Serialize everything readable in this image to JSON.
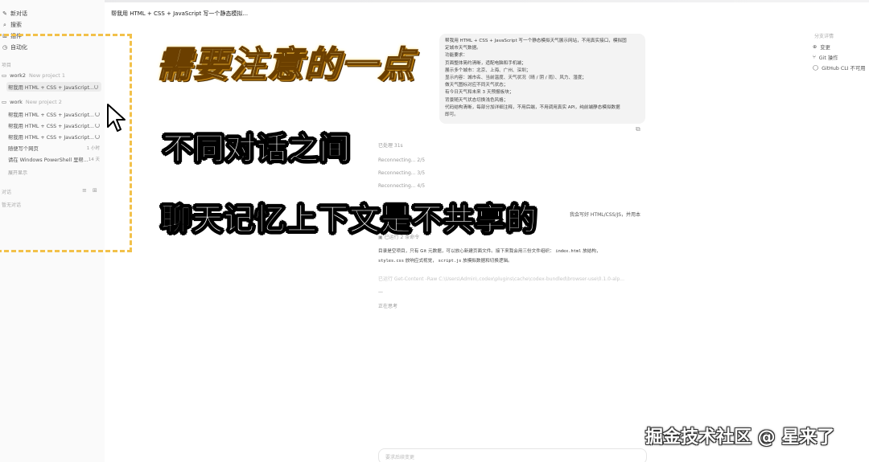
{
  "sidebar": {
    "nav": [
      {
        "icon": "✎",
        "label": "新对话"
      },
      {
        "icon": "⌕",
        "label": "搜索"
      },
      {
        "icon": "⊞",
        "label": "插件"
      },
      {
        "icon": "◷",
        "label": "自动化"
      }
    ],
    "projects_label": "项目",
    "projects": [
      {
        "name": "work2",
        "sub": "New project 1"
      },
      {
        "name": "work",
        "sub": "New project 2"
      }
    ],
    "chats_p1": [
      {
        "title": "帮我用 HTML + CSS + JavaScript...",
        "meta": ""
      }
    ],
    "chats_p2": [
      {
        "title": "帮我用 HTML + CSS + JavaScript...",
        "meta": ""
      },
      {
        "title": "帮我用 HTML + CSS + JavaScript...",
        "meta": ""
      },
      {
        "title": "帮我用 HTML + CSS + JavaScript...",
        "meta": ""
      },
      {
        "title": "随便写个网页",
        "meta": "1 小时"
      },
      {
        "title": "请在 Windows PowerShell 里帮...",
        "meta": "14 天"
      }
    ],
    "expand_label": "展开显示",
    "threads_label": "对话",
    "no_threads": "暂无对话"
  },
  "header": {
    "title": "帮我用 HTML + CSS + JavaScript 写一个静态模拟..."
  },
  "overlays": {
    "yellow": "需要注意的一点",
    "line1": "不同对话之间",
    "line2": "聊天记忆上下文是不共享的"
  },
  "user_message": [
    "帮我用 HTML + CSS + JavaScript 写一个静态模拟天气展示网站，不用真实接口，模拟固",
    "定城市天气数据。",
    "功能要求：",
    "页面整体简约清晰，适配电脑和手机端；",
    "展示多个城市：北京、上海、广州、深圳；",
    "显示内容：城市名、当前温度、天气状况（晴 / 阴 / 雨）、风力、湿度；",
    "做天气图标对应不同天气状态；",
    "有今日天气和未来 3 天预报板块；",
    "背景随天气状态切换浅色风格；",
    "代码结构清晰，每部分加详细注释，不用后端，不用调用真实 API，纯前端静态模拟数据",
    "即可。"
  ],
  "status_lines": [
    "已处理 31s",
    "Reconnecting... 2/5",
    "Reconnecting... 3/5",
    "Reconnecting... 4/5"
  ],
  "partial_reply_right": "我会写好 HTML/CSS/JS，并用本",
  "ran_label": "已运行 2 条命令",
  "reply": {
    "line1_a": "目录是空项目，只有 Git 元数据，可以放心新建页面文件。接下来我会用三份文件组织：",
    "line1_code": "index.html",
    "line1_b": "放结构，",
    "line2_code1": "styles.css",
    "line2_a": "放响应式视觉，",
    "line2_code2": "script.js",
    "line2_b": "放模拟数据和切换逻辑。"
  },
  "ran_cmd": "已运行 Get-Content -Raw C:\\Users\\Admin\\.codex\\plugins\\cache\\codex-bundled\\browser-use\\0.1.0-alp...",
  "thinking": "正在思考",
  "right_panel": {
    "title": "分支详情",
    "items": [
      {
        "icon": "⊕",
        "label": "变更"
      },
      {
        "icon": "⑂",
        "label": "Git 操作"
      },
      {
        "icon": "◯",
        "label": "GitHub CLI 不可用"
      }
    ]
  },
  "input_placeholder": "要求后续变更",
  "watermark": "掘金技术社区 @ 星来了",
  "colors": {
    "dash": "#f2c14a",
    "overlay_yellow": "#fff2b0"
  }
}
